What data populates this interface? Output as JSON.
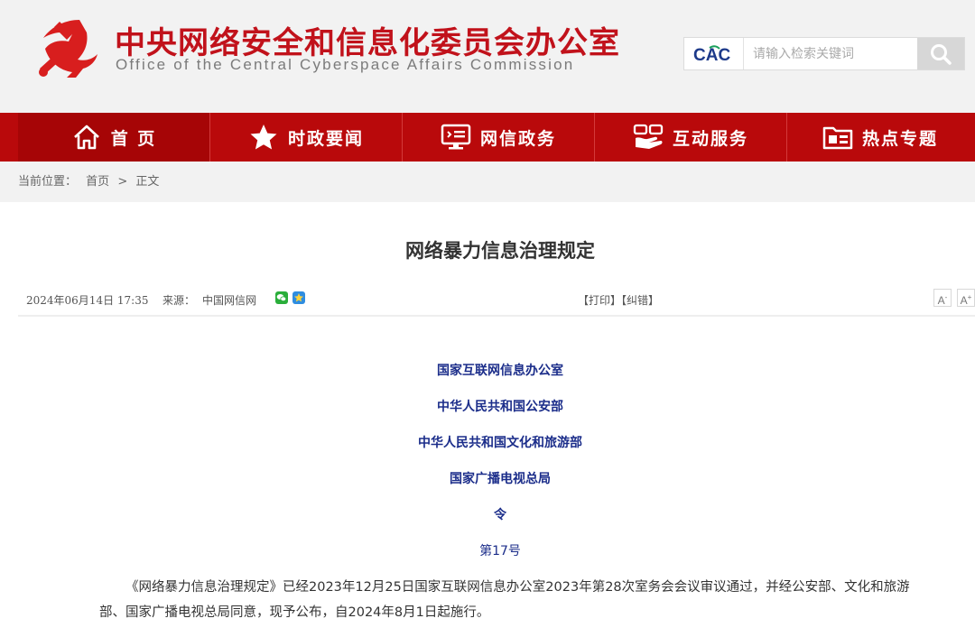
{
  "header": {
    "site_title": "中央网络安全和信息化委员会办公室",
    "site_subtitle": "Office of the Central Cyberspace Affairs Commission",
    "search_logo_text": "CAC",
    "search_placeholder": "请输入检索关键词"
  },
  "nav": {
    "items": [
      {
        "label": "首 页",
        "icon": "home-icon"
      },
      {
        "label": "时政要闻",
        "icon": "star-icon"
      },
      {
        "label": "网信政务",
        "icon": "monitor-icon"
      },
      {
        "label": "互动服务",
        "icon": "handshake-icon"
      },
      {
        "label": "热点专题",
        "icon": "folder-icon"
      }
    ]
  },
  "breadcrumb": {
    "prefix": "当前位置：",
    "home": "首页",
    "separator": ">",
    "current": "正文"
  },
  "article": {
    "title": "网络暴力信息治理规定",
    "date": "2024年06月14日 17:35",
    "source_label": "来源：",
    "source": "中国网信网",
    "print_label": "【打印】",
    "correct_label": "【纠错】",
    "font_smaller": "A",
    "font_larger": "A",
    "issuers": [
      "国家互联网信息办公室",
      "中华人民共和国公安部",
      "中华人民共和国文化和旅游部",
      "国家广播电视总局"
    ],
    "order_label": "令",
    "order_number": "第17号",
    "paragraph": "《网络暴力信息治理规定》已经2023年12月25日国家互联网信息办公室2023年第28次室务会会议审议通过，并经公安部、文化和旅游部、国家广播电视总局同意，现予公布，自2024年8月1日起施行。"
  },
  "colors": {
    "brand_red": "#c1121b",
    "nav_red": "#b9090b",
    "issuer_blue": "#1b2d8a"
  }
}
